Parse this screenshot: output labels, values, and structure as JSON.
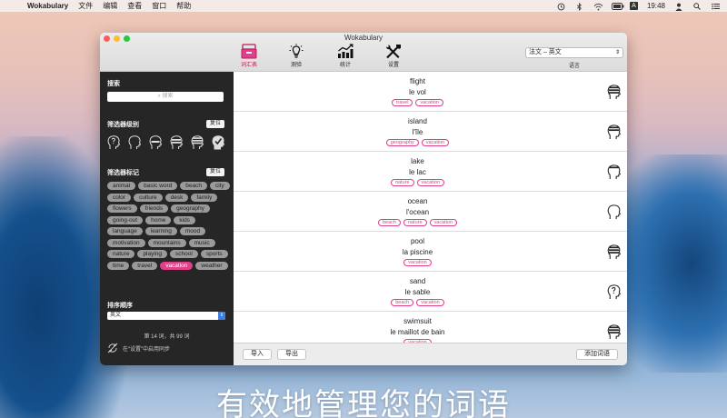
{
  "menubar": {
    "app_name": "Wokabulary",
    "menus": [
      "文件",
      "编辑",
      "查看",
      "窗口",
      "帮助"
    ],
    "clock": "19:48",
    "input_indicator": "A"
  },
  "window": {
    "title": "Wokabulary",
    "toolbar": [
      {
        "label": "词汇表",
        "icon": "vocabulary-list-icon",
        "active": true
      },
      {
        "label": "测验",
        "icon": "lightbulb-icon",
        "active": false
      },
      {
        "label": "统计",
        "icon": "statistics-icon",
        "active": false
      },
      {
        "label": "设置",
        "icon": "settings-tools-icon",
        "active": false
      }
    ],
    "language": {
      "value": "法文 – 英文",
      "caption": "语言"
    }
  },
  "sidebar": {
    "search_heading": "搜索",
    "search_placeholder": "搜索",
    "level_filter_heading": "筛选器级别",
    "level_reset": "复位",
    "tag_filter_heading": "筛选器标记",
    "tag_reset": "复位",
    "tags": [
      {
        "label": "animal",
        "selected": false
      },
      {
        "label": "basic word",
        "selected": false
      },
      {
        "label": "beach",
        "selected": false
      },
      {
        "label": "city",
        "selected": false
      },
      {
        "label": "color",
        "selected": false
      },
      {
        "label": "culture",
        "selected": false
      },
      {
        "label": "desk",
        "selected": false
      },
      {
        "label": "family",
        "selected": false
      },
      {
        "label": "flowers",
        "selected": false
      },
      {
        "label": "friends",
        "selected": false
      },
      {
        "label": "geography",
        "selected": false
      },
      {
        "label": "going-out",
        "selected": false
      },
      {
        "label": "home",
        "selected": false
      },
      {
        "label": "kids",
        "selected": false
      },
      {
        "label": "language",
        "selected": false
      },
      {
        "label": "learning",
        "selected": false
      },
      {
        "label": "mood",
        "selected": false
      },
      {
        "label": "motivation",
        "selected": false
      },
      {
        "label": "mountains",
        "selected": false
      },
      {
        "label": "music",
        "selected": false
      },
      {
        "label": "nature",
        "selected": false
      },
      {
        "label": "playing",
        "selected": false
      },
      {
        "label": "school",
        "selected": false
      },
      {
        "label": "sports",
        "selected": false
      },
      {
        "label": "time",
        "selected": false
      },
      {
        "label": "travel",
        "selected": false
      },
      {
        "label": "vacation",
        "selected": true
      },
      {
        "label": "weather",
        "selected": false
      }
    ],
    "sort_heading": "排序顺序",
    "sort_value": "英文",
    "count_text": "第 14 词，共 99 词",
    "sync_text": "在“设置”中启用同步"
  },
  "words": [
    {
      "word": "flight",
      "translation": "le vol",
      "tags": [
        "travel",
        "vacation"
      ],
      "level": 4
    },
    {
      "word": "island",
      "translation": "l'île",
      "tags": [
        "geography",
        "vacation"
      ],
      "level": 3
    },
    {
      "word": "lake",
      "translation": "le lac",
      "tags": [
        "nature",
        "vacation"
      ],
      "level": 2
    },
    {
      "word": "ocean",
      "translation": "l'ocean",
      "tags": [
        "beach",
        "nature",
        "vacation"
      ],
      "level": 1
    },
    {
      "word": "pool",
      "translation": "la piscine",
      "tags": [
        "vacation"
      ],
      "level": 4
    },
    {
      "word": "sand",
      "translation": "le sable",
      "tags": [
        "beach",
        "vacation"
      ],
      "level": 0
    },
    {
      "word": "swimsuit",
      "translation": "le maillot de bain",
      "tags": [
        "vacation"
      ],
      "level": 4
    }
  ],
  "bottom": {
    "import_label": "导入",
    "export_label": "导出",
    "add_word_label": "添加词语"
  },
  "caption": "有效地管理您的词语",
  "colors": {
    "accent": "#e0408a",
    "sidebar_bg": "#262626"
  }
}
